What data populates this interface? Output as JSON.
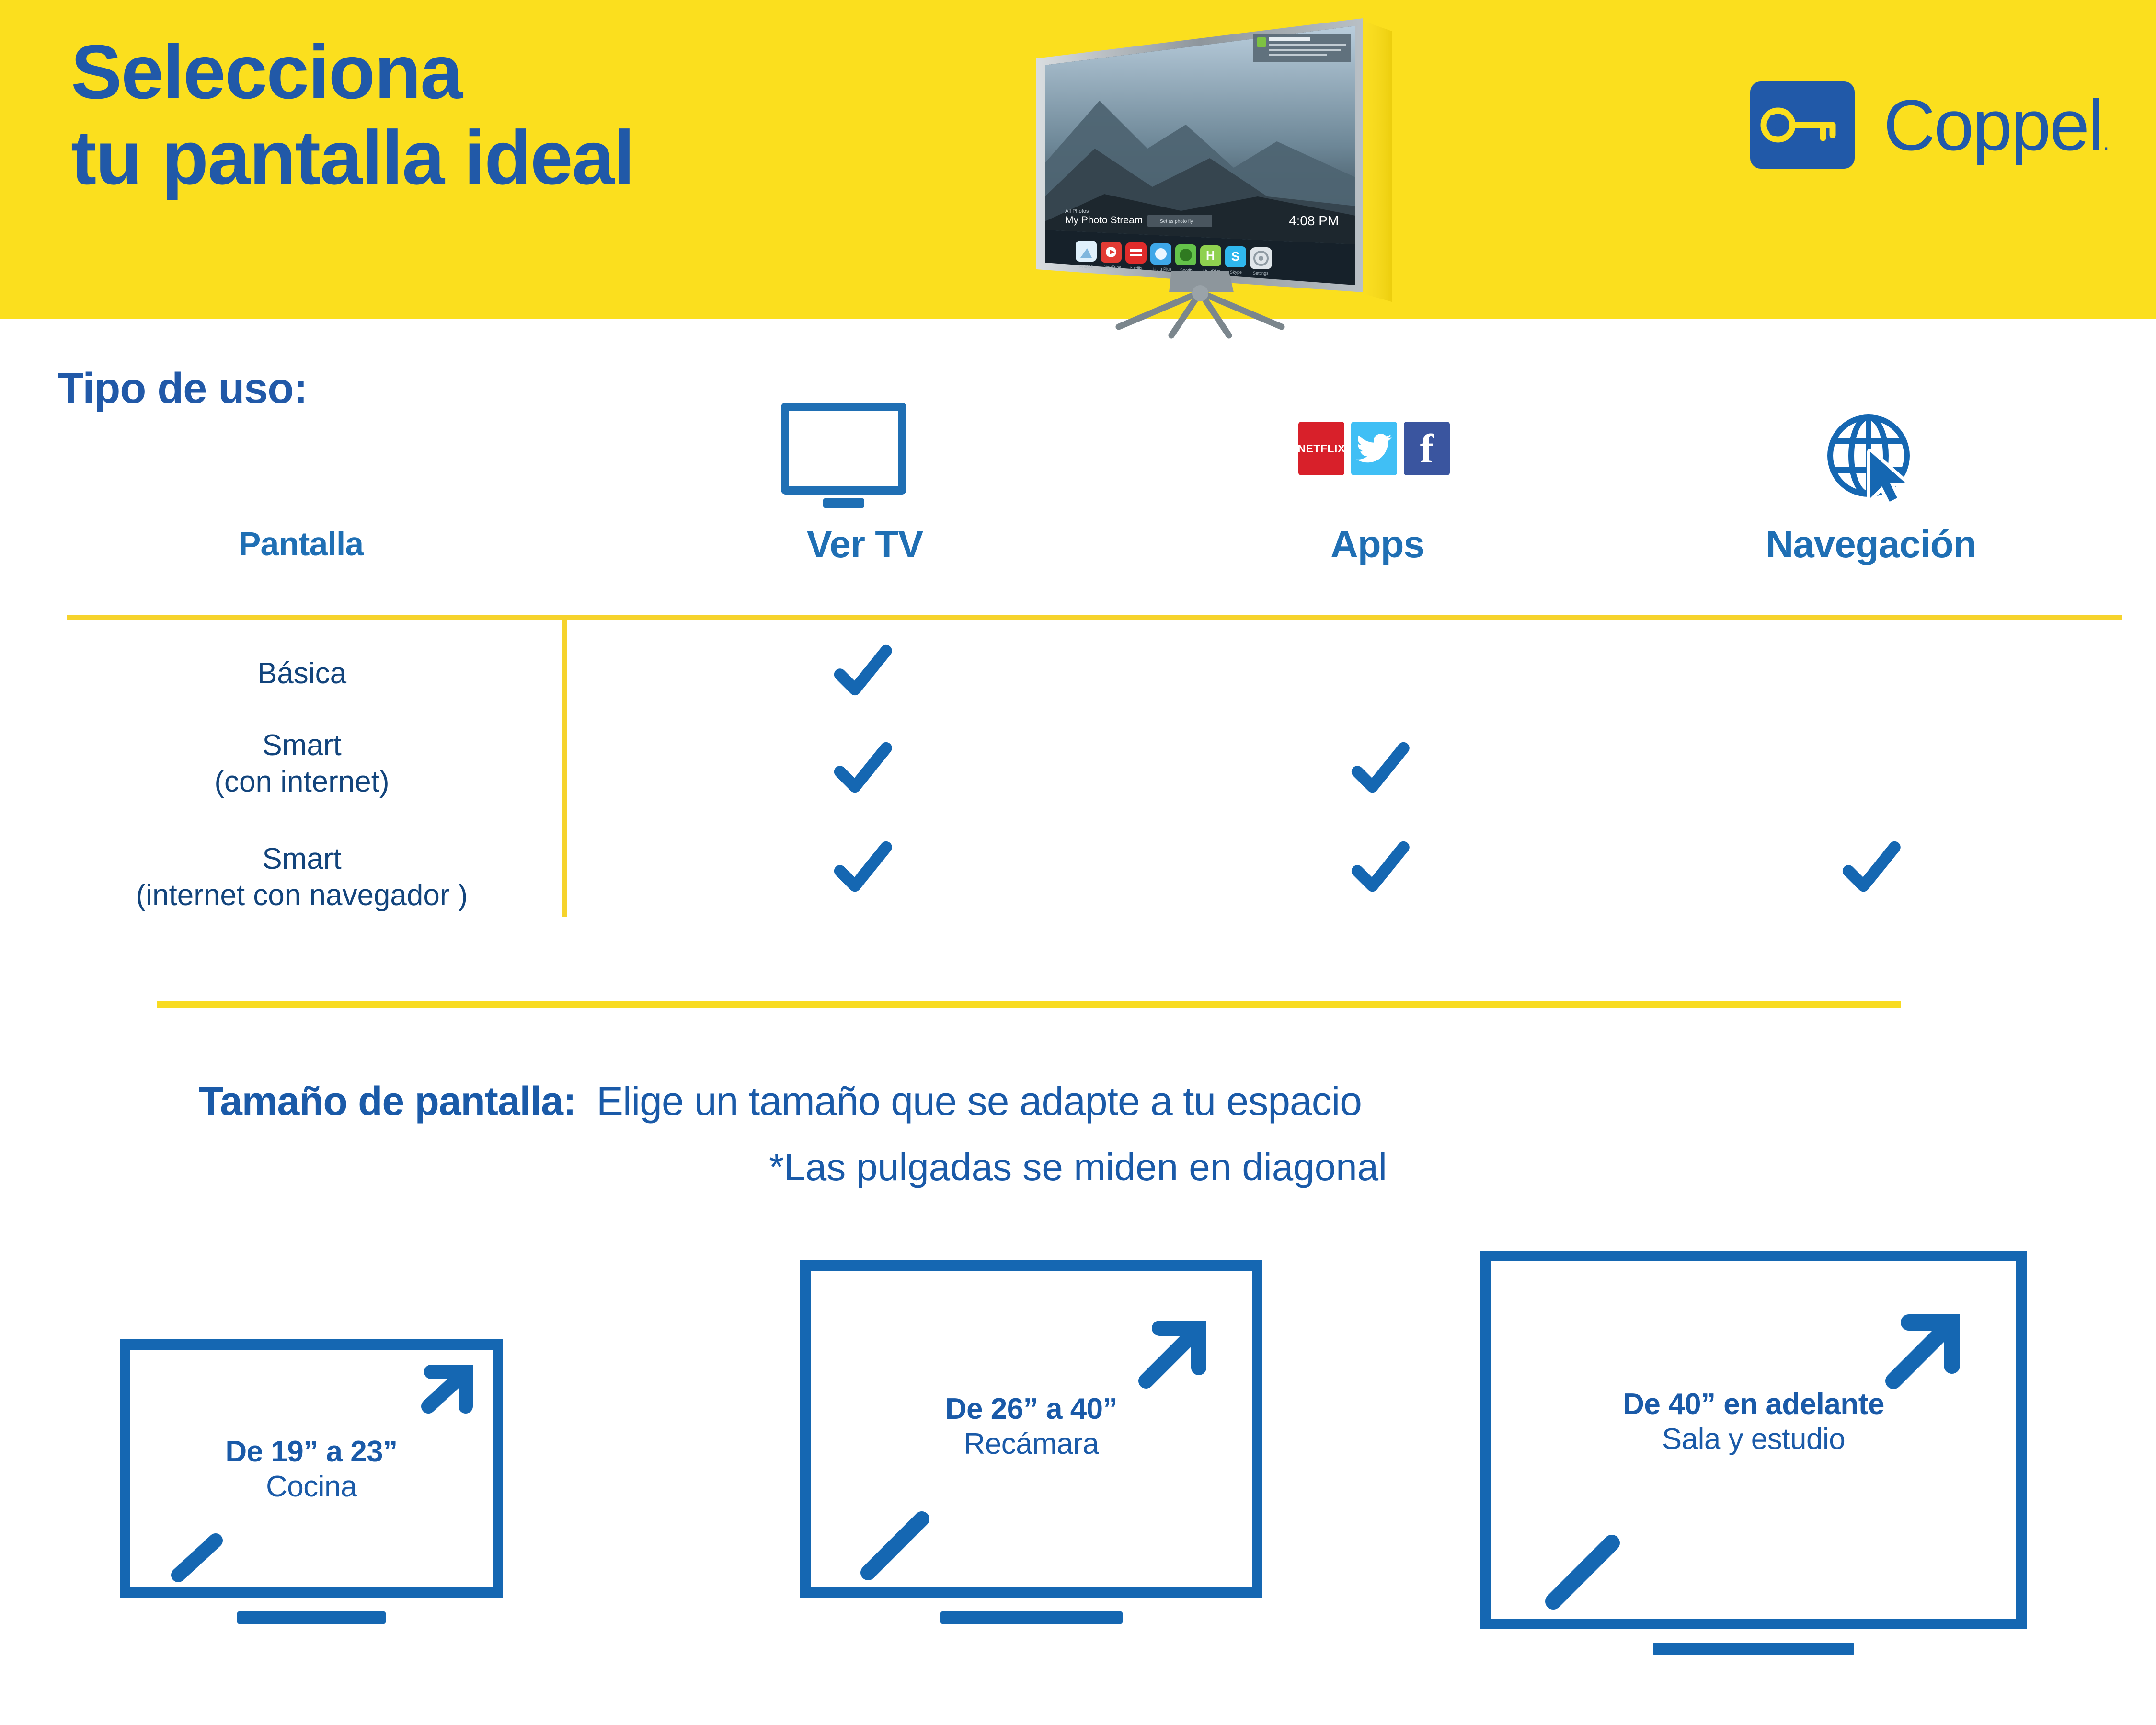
{
  "header": {
    "headline": "Selecciona\ntu pantalla ideal",
    "brand_name": "Coppel",
    "brand_registered": ".",
    "brand_icon": "key-icon",
    "tv_photo": {
      "label": "smart-tv-photo",
      "screen_title": "My Photo Stream",
      "screen_subtitle": "All Photos",
      "clock": "4:08 PM",
      "notification_title": "Nightly Update",
      "apps": [
        "Photos",
        "YouTube",
        "Netflix",
        "Hulu Plus",
        "Spotify",
        "HuluPlus",
        "Skype",
        "Settings"
      ]
    },
    "colors": {
      "band": "#FBDF1E",
      "title": "#2159A8"
    }
  },
  "usage_section": {
    "label": "Tipo de uso:",
    "columns": [
      {
        "key": "pantalla",
        "label": "Pantalla",
        "icon": ""
      },
      {
        "key": "ver_tv",
        "label": "Ver TV",
        "icon": "monitor-icon"
      },
      {
        "key": "apps",
        "label": "Apps",
        "icon": "app-logos-icon",
        "app_logos": [
          {
            "name": "netflix-icon",
            "text": "NETFLIX",
            "color": "#D8202A"
          },
          {
            "name": "twitter-icon",
            "text": "",
            "color": "#40BFF5"
          },
          {
            "name": "facebook-icon",
            "text": "f",
            "color": "#3A559F"
          }
        ]
      },
      {
        "key": "navegacion",
        "label": "Navegación",
        "icon": "globe-cursor-icon"
      }
    ],
    "rows": [
      {
        "label": "Básica",
        "ver_tv": true,
        "apps": false,
        "navegacion": false
      },
      {
        "label": "Smart\n(con internet)",
        "ver_tv": true,
        "apps": true,
        "navegacion": false
      },
      {
        "label": "Smart\n(internet con navegador )",
        "ver_tv": true,
        "apps": true,
        "navegacion": true
      }
    ],
    "check_icon": "checkmark-icon",
    "colors": {
      "divider": "#F6D32C",
      "text": "#12447C",
      "accent": "#1F6FB4"
    }
  },
  "size_section": {
    "heading_bold": "Tamaño de pantalla:",
    "heading_rest": "Elige un tamaño que se adapte a tu espacio",
    "note": "*Las pulgadas se miden en diagonal",
    "boxes": [
      {
        "range": "De 19” a 23”",
        "room": "Cocina",
        "diagonal_icon": "diagonal-arrow-icon"
      },
      {
        "range": "De 26” a 40”",
        "room": "Recámara",
        "diagonal_icon": "diagonal-arrow-icon"
      },
      {
        "range": "De 40” en adelante",
        "room": "Sala y estudio",
        "diagonal_icon": "diagonal-arrow-icon"
      }
    ],
    "colors": {
      "frame": "#1567B2",
      "text": "#1A5AA8"
    }
  }
}
